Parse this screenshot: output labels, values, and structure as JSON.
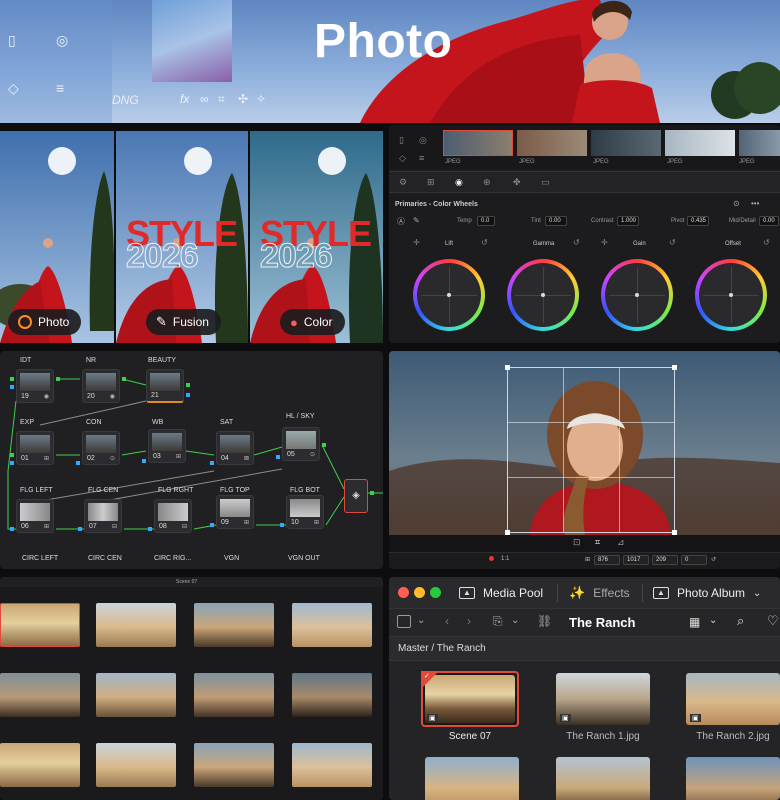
{
  "banner": {
    "title": "Photo",
    "format_label": "DNG"
  },
  "style_panels": [
    {
      "pill_label": "Photo",
      "overlay_text": "",
      "overlay_year": ""
    },
    {
      "pill_label": "Fusion",
      "overlay_text": "STYLE",
      "overlay_year": "2026"
    },
    {
      "pill_label": "Color",
      "overlay_text": "STYLE",
      "overlay_year": "2026"
    }
  ],
  "color_page": {
    "strip_labels": [
      "JPEG",
      "JPEG",
      "JPEG",
      "JPEG",
      "JPEG"
    ],
    "panel_title": "Primaries - Color Wheels",
    "params": [
      {
        "label": "Temp",
        "value": "0.0"
      },
      {
        "label": "Tint",
        "value": "0.00"
      },
      {
        "label": "Contrast",
        "value": "1.000"
      },
      {
        "label": "Pivot",
        "value": "0.435"
      },
      {
        "label": "Mid/Detail",
        "value": "0.00"
      }
    ],
    "wheels": [
      "Lift",
      "Gamma",
      "Gain",
      "Offset"
    ]
  },
  "node_graph": {
    "nodes": [
      {
        "label": "IDT",
        "num": "19"
      },
      {
        "label": "NR",
        "num": "20"
      },
      {
        "label": "BEAUTY",
        "num": "21"
      },
      {
        "label": "EXP",
        "num": "01"
      },
      {
        "label": "CON",
        "num": "02"
      },
      {
        "label": "WB",
        "num": "03"
      },
      {
        "label": "SAT",
        "num": "04"
      },
      {
        "label": "HL / SKY",
        "num": "05"
      },
      {
        "label": "FLG LEFT",
        "num": "06"
      },
      {
        "label": "FLG CEN",
        "num": "07"
      },
      {
        "label": "FLG RGHT",
        "num": "08"
      },
      {
        "label": "FLG TOP",
        "num": "09"
      },
      {
        "label": "FLG BOT",
        "num": "10"
      }
    ],
    "bottom_labels": [
      "CIRC LEFT",
      "CIRC CEN",
      "CIRC RIG...",
      "VGN",
      "VGN OUT"
    ]
  },
  "viewer": {
    "zoom": "1:1",
    "coords": [
      "876",
      "1017",
      "209",
      "0"
    ]
  },
  "media_grid": {
    "title": "Scene 07"
  },
  "media_pool": {
    "tabs": [
      {
        "label": "Media Pool",
        "icon": "media-pool-icon"
      },
      {
        "label": "Effects",
        "icon": "effects-icon"
      },
      {
        "label": "Photo Album",
        "icon": "photo-album-icon"
      }
    ],
    "bin_title": "The Ranch",
    "breadcrumb": "Master / The Ranch",
    "clips": [
      "Scene 07",
      "The Ranch 1.jpg",
      "The Ranch 2.jpg"
    ]
  }
}
